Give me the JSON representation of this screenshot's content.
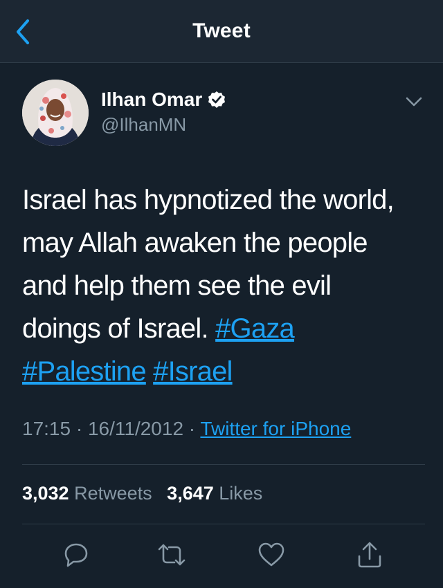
{
  "navbar": {
    "title": "Tweet",
    "back_icon": "chevron-left-icon"
  },
  "author": {
    "display_name": "Ilhan Omar",
    "handle": "@IlhanMN",
    "verified": true,
    "verified_icon": "verified-badge-icon"
  },
  "tweet": {
    "lines": [
      [
        {
          "text": "Israel has hypnotized the world,"
        }
      ],
      [
        {
          "text": "may Allah awaken the people"
        }
      ],
      [
        {
          "text": "and help them see the evil"
        }
      ],
      [
        {
          "text": "doings of Israel. "
        },
        {
          "text": "#Gaza",
          "hashtag": true
        }
      ],
      [
        {
          "text": "#Palestine",
          "hashtag": true
        },
        {
          "text": " "
        },
        {
          "text": "#Israel",
          "hashtag": true
        }
      ]
    ]
  },
  "meta": {
    "time": "17:15",
    "separator": " · ",
    "date": "16/11/2012",
    "source": "Twitter for iPhone"
  },
  "stats": {
    "retweets_count": "3,032",
    "retweets_label": "Retweets",
    "likes_count": "3,647",
    "likes_label": "Likes"
  },
  "actions": {
    "reply": "reply-icon",
    "retweet": "retweet-icon",
    "like": "like-icon",
    "share": "share-icon"
  },
  "colors": {
    "background": "#15202b",
    "navbar": "#1c2733",
    "link": "#1da1f2",
    "secondary_text": "#8899a6",
    "divider": "#2f3c48"
  }
}
